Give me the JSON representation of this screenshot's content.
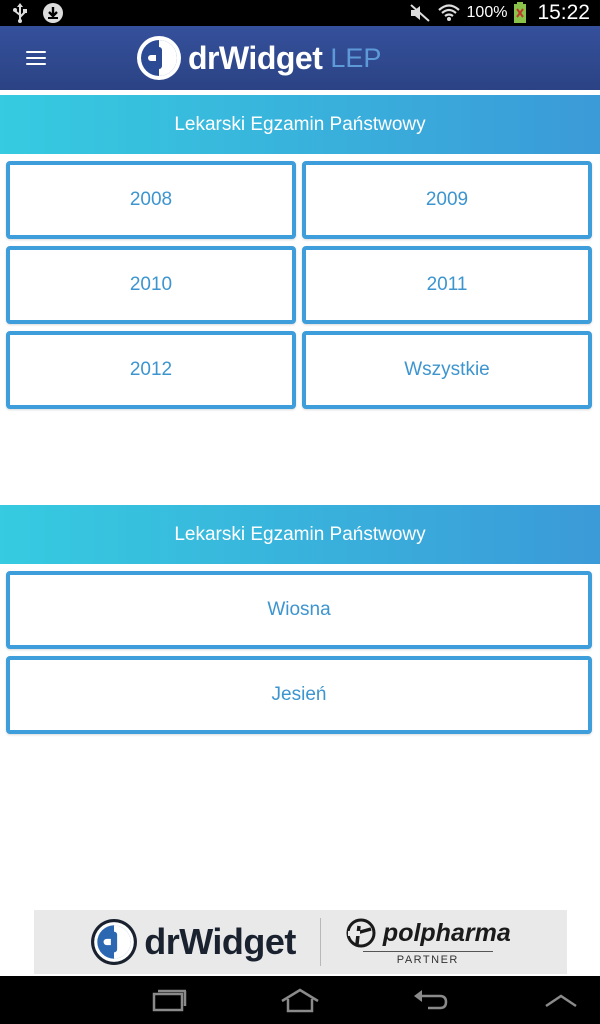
{
  "status_bar": {
    "battery_text": "100%",
    "time": "15:22",
    "icons": [
      "usb-icon",
      "download-icon",
      "mute-icon",
      "wifi-icon",
      "battery-icon"
    ]
  },
  "app_bar": {
    "brand": "drWidget",
    "brand_suffix": "LEP",
    "menu_icon": "hamburger-menu-icon"
  },
  "section1": {
    "title": "Lekarski Egzamin Państwowy",
    "tiles": [
      "2008",
      "2009",
      "2010",
      "2011",
      "2012",
      "Wszystkie"
    ]
  },
  "section2": {
    "title": "Lekarski Egzamin Państwowy",
    "tiles": [
      "Wiosna",
      "Jesień"
    ]
  },
  "footer": {
    "brand": "drWidget",
    "partner_name": "polpharma",
    "partner_label": "PARTNER"
  },
  "nav_bar": {
    "icons": [
      "recent-apps-icon",
      "home-icon",
      "back-icon",
      "up-chevron-icon"
    ]
  },
  "colors": {
    "app_bar": "#2f4a92",
    "header_gradient_start": "#36cbe0",
    "header_gradient_end": "#3b9ad8",
    "tile_border": "#3d9edb",
    "tile_text": "#3d95cf"
  }
}
